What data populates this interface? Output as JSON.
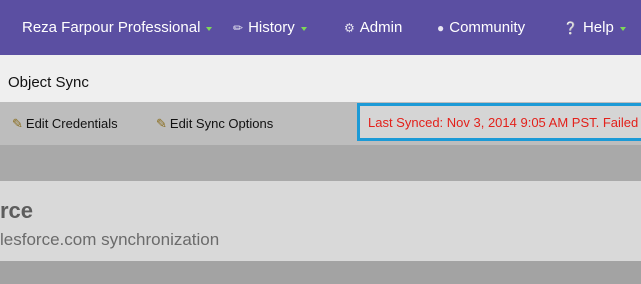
{
  "nav": {
    "account_label": "Reza Farpour Professional",
    "history_label": "History",
    "admin_label": "Admin",
    "community_label": "Community",
    "help_label": "Help"
  },
  "page": {
    "title": "Object Sync"
  },
  "toolbar": {
    "edit_credentials_label": "Edit Credentials",
    "edit_sync_options_label": "Edit Sync Options",
    "status_text": "Last Synced: Nov 3, 2014 9:05 AM PST. Failed"
  },
  "panel": {
    "heading": "rce",
    "subtitle": "lesforce.com synchronization"
  },
  "colors": {
    "nav_bg": "#5b4fa2",
    "accent_caret": "#7ed957",
    "status_border": "#1c9ad6",
    "status_text": "#e3211b"
  }
}
